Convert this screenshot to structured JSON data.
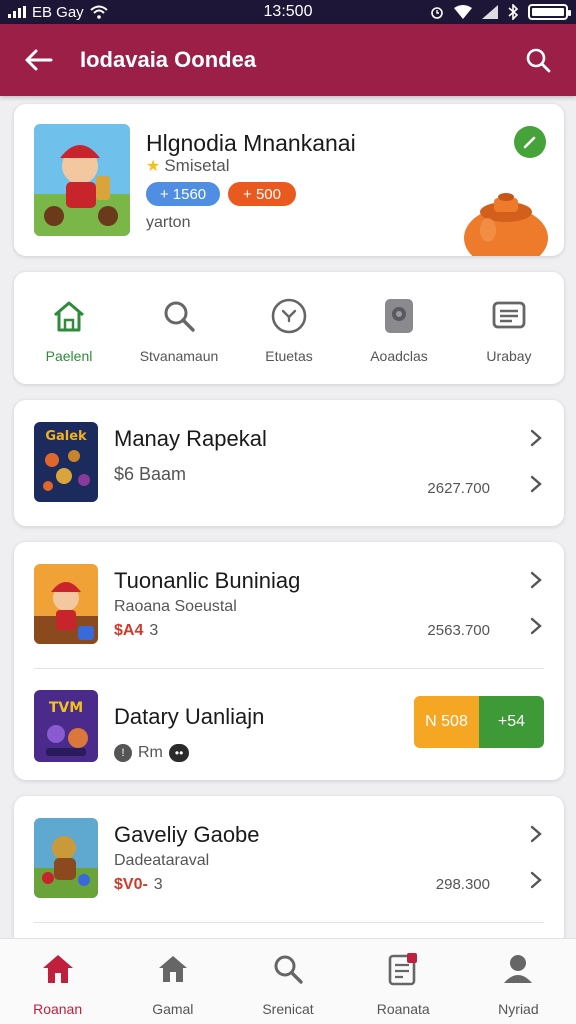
{
  "status_bar": {
    "carrier": "EB Gay",
    "time": "13:500"
  },
  "app_bar": {
    "title": "Iodavaia Oondea"
  },
  "featured": {
    "title": "Hlgnodia Mnankanai",
    "subtitle": "Smisetal",
    "pill_blue": "+ 1560",
    "pill_orange": "+ 500",
    "footer": "yarton"
  },
  "categories": [
    {
      "label": "Paelenl",
      "icon": "home-outline-icon"
    },
    {
      "label": "Stvanamaun",
      "icon": "search-icon"
    },
    {
      "label": "Etuetas",
      "icon": "compass-icon"
    },
    {
      "label": "Aoadclas",
      "icon": "device-icon"
    },
    {
      "label": "Urabay",
      "icon": "message-icon"
    }
  ],
  "games": [
    {
      "title": "Manay Rapekal",
      "subtitle": "",
      "meta": "$6 Baam",
      "amount": "2627.700"
    },
    {
      "title": "Tuonanlic Buniniag",
      "subtitle": "Raoana Soeustal",
      "meta": "$A4",
      "meta_extra": "3",
      "amount": "2563.700"
    },
    {
      "title": "Datary Uanliajn",
      "subtitle": "",
      "meta": "Rm",
      "button_left": "N 508",
      "button_right": "+54"
    },
    {
      "title": "Gaveliy Gaobe",
      "subtitle": "Dadeataraval",
      "meta": "$V0-",
      "meta_extra": "3",
      "amount": "298.300"
    }
  ],
  "bottom_nav": [
    {
      "label": "Roanan",
      "icon": "home-icon"
    },
    {
      "label": "Gamal",
      "icon": "house-icon"
    },
    {
      "label": "Srenicat",
      "icon": "search-icon"
    },
    {
      "label": "Roanata",
      "icon": "document-icon"
    },
    {
      "label": "Nyriad",
      "icon": "person-icon"
    }
  ],
  "colors": {
    "accent": "#9b1f47",
    "status_bar": "#1d1637",
    "green": "#3e9a36",
    "orange": "#f5a623",
    "nav_active": "#c0203d"
  }
}
